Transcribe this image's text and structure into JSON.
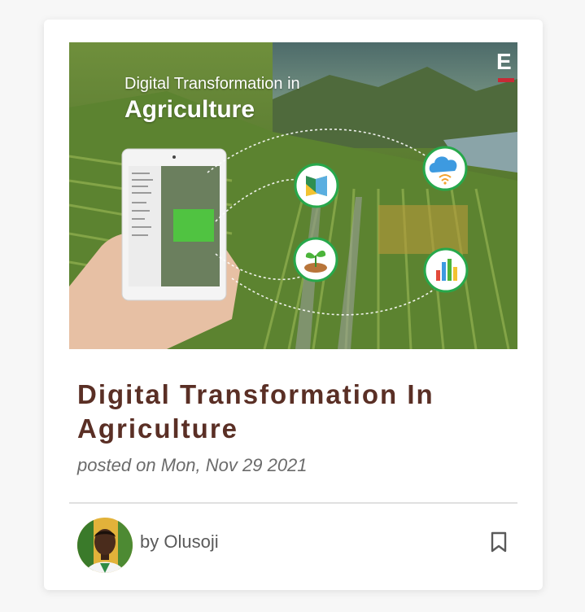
{
  "hero": {
    "line1": "Digital Transformation in",
    "line2": "Agriculture",
    "brand": "E"
  },
  "post": {
    "title": "Digital Transformation In Agriculture",
    "date": "posted on Mon, Nov 29 2021",
    "author": "by Olusoji"
  },
  "colors": {
    "title": "#5a2f25",
    "brand_accent": "#c72a35"
  },
  "icons": [
    "map-icon",
    "cloud-wifi-icon",
    "plant-icon",
    "bar-chart-icon",
    "bookmark-icon"
  ]
}
